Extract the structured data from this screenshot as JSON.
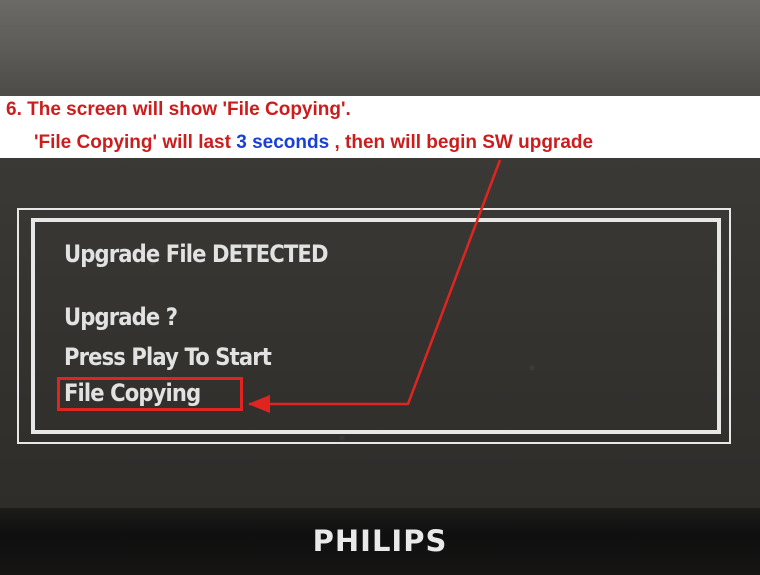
{
  "instruction": {
    "line1": "6. The screen will show 'File Copying'.",
    "line2_prefix": "'File Copying' will last",
    "line2_number": "3 seconds",
    "line2_suffix": ", then will begin SW upgrade",
    "text_color": "#cc1d1d",
    "highlight_color": "#1a3fd6"
  },
  "osd": {
    "detected": "Upgrade File DETECTED",
    "question": "Upgrade ?",
    "prompt": "Press Play To Start",
    "status": "File Copying"
  },
  "annotation": {
    "box_color": "#e0241f",
    "arrow_color": "#e0241f"
  },
  "device": {
    "brand": "PHILIPS"
  }
}
